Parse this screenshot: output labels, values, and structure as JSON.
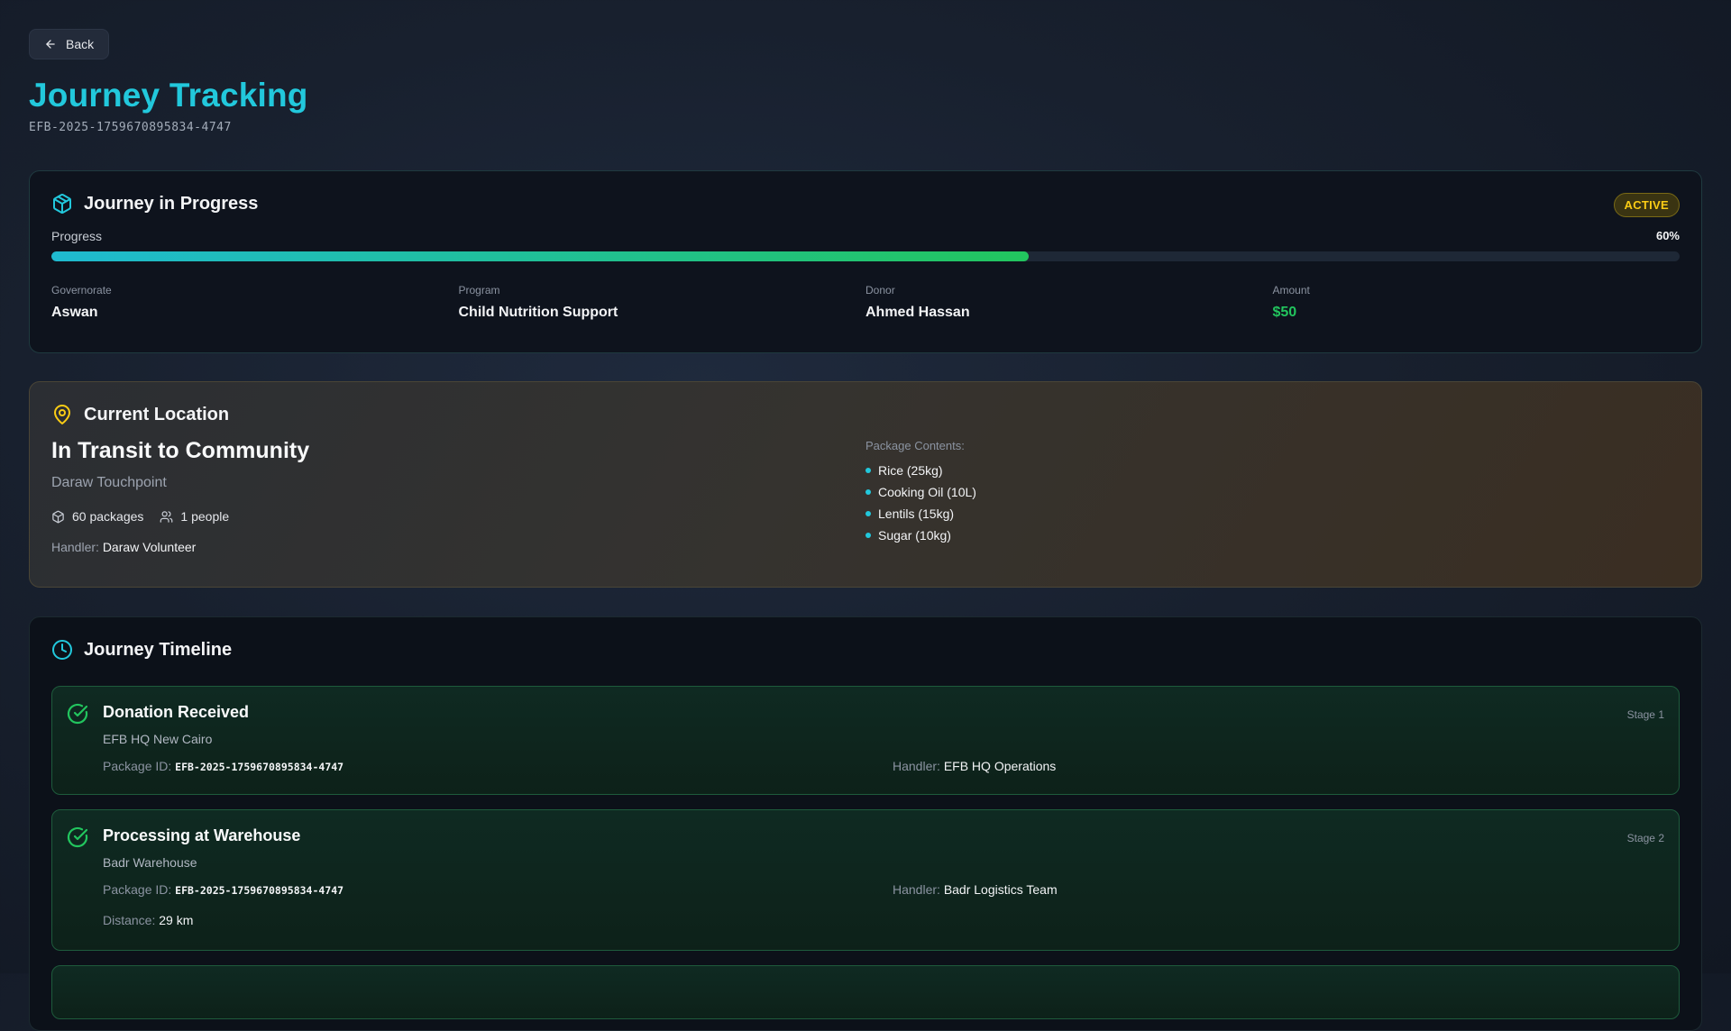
{
  "header": {
    "back_label": "Back",
    "title": "Journey Tracking",
    "journey_id": "EFB-2025-1759670895834-4747"
  },
  "progress_card": {
    "title": "Journey in Progress",
    "status": "ACTIVE",
    "progress_label": "Progress",
    "progress_text": "60%",
    "progress_fraction": 0.6,
    "fields": [
      {
        "label": "Governorate",
        "value": "Aswan"
      },
      {
        "label": "Program",
        "value": "Child Nutrition Support"
      },
      {
        "label": "Donor",
        "value": "Ahmed Hassan"
      },
      {
        "label": "Amount",
        "value": "$50"
      }
    ]
  },
  "location_card": {
    "title": "Current Location",
    "status": "In Transit to Community",
    "touchpoint": "Daraw Touchpoint",
    "packages": "60 packages",
    "people": "1 people",
    "handler_label": "Handler:",
    "handler": "Daraw Volunteer",
    "contents_label": "Package Contents:",
    "contents": [
      "Rice (25kg)",
      "Cooking Oil (10L)",
      "Lentils (15kg)",
      "Sugar (10kg)"
    ]
  },
  "timeline": {
    "title": "Journey Timeline",
    "stages": [
      {
        "title": "Donation Received",
        "stage": "Stage 1",
        "location": "EFB HQ New Cairo",
        "package_label": "Package ID:",
        "package_id": "EFB-2025-1759670895834-4747",
        "handler_label": "Handler:",
        "handler": "EFB HQ Operations"
      },
      {
        "title": "Processing at Warehouse",
        "stage": "Stage 2",
        "location": "Badr Warehouse",
        "package_label": "Package ID:",
        "package_id": "EFB-2025-1759670895834-4747",
        "handler_label": "Handler:",
        "handler": "Badr Logistics Team",
        "distance_label": "Distance:",
        "distance": "29 km"
      }
    ]
  },
  "colors": {
    "accent": "#22c8dc",
    "success": "#22c55e",
    "warning": "#facc15"
  },
  "icons": {
    "back": "arrow-left-icon",
    "journey": "package-icon",
    "location": "map-pin-icon",
    "timeline": "clock-icon",
    "stage_done": "check-circle-icon",
    "packages": "box-icon",
    "people": "users-icon"
  }
}
